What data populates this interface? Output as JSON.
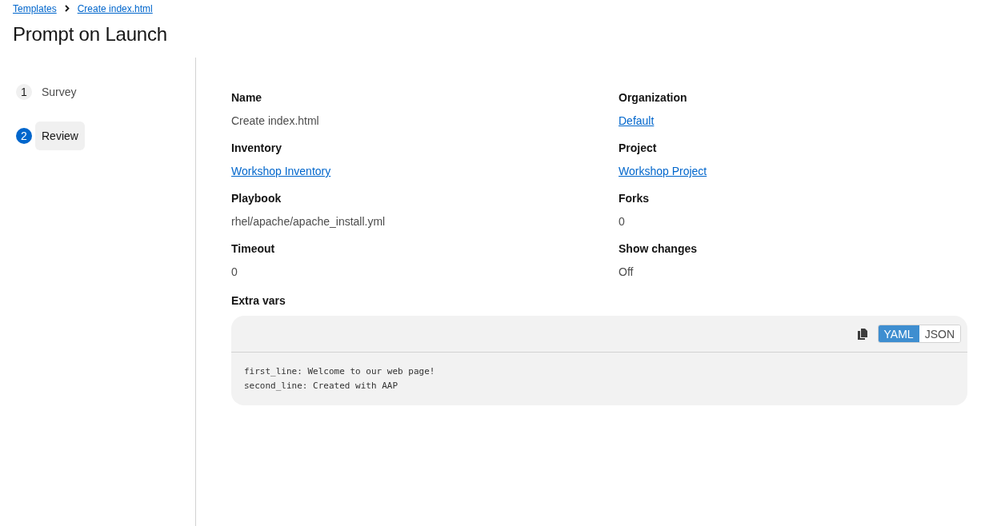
{
  "breadcrumb": [
    {
      "label": "Templates"
    },
    {
      "label": "Create index.html"
    }
  ],
  "title": "Prompt on Launch",
  "steps": [
    {
      "number": "1",
      "label": "Survey",
      "selected": false
    },
    {
      "number": "2",
      "label": "Review",
      "selected": true
    }
  ],
  "details": [
    {
      "label": "Name",
      "value": "Create index.html",
      "kind": "text"
    },
    {
      "label": "Organization",
      "value": "Default",
      "kind": "link"
    },
    {
      "label": "Inventory",
      "value": "Workshop Inventory",
      "kind": "link"
    },
    {
      "label": "Project",
      "value": "Workshop Project",
      "kind": "link"
    },
    {
      "label": "Playbook",
      "value": "rhel/apache/apache_install.yml",
      "kind": "text"
    },
    {
      "label": "Forks",
      "value": "0",
      "kind": "text"
    },
    {
      "label": "Timeout",
      "value": "0",
      "kind": "text"
    },
    {
      "label": "Show changes",
      "value": "Off",
      "kind": "text"
    }
  ],
  "extra_vars": {
    "label": "Extra vars",
    "formats": [
      {
        "label": "YAML",
        "selected": true
      },
      {
        "label": "JSON",
        "selected": false
      }
    ],
    "lines": [
      "first_line: Welcome to our web page!",
      "second_line: Created with AAP"
    ]
  }
}
